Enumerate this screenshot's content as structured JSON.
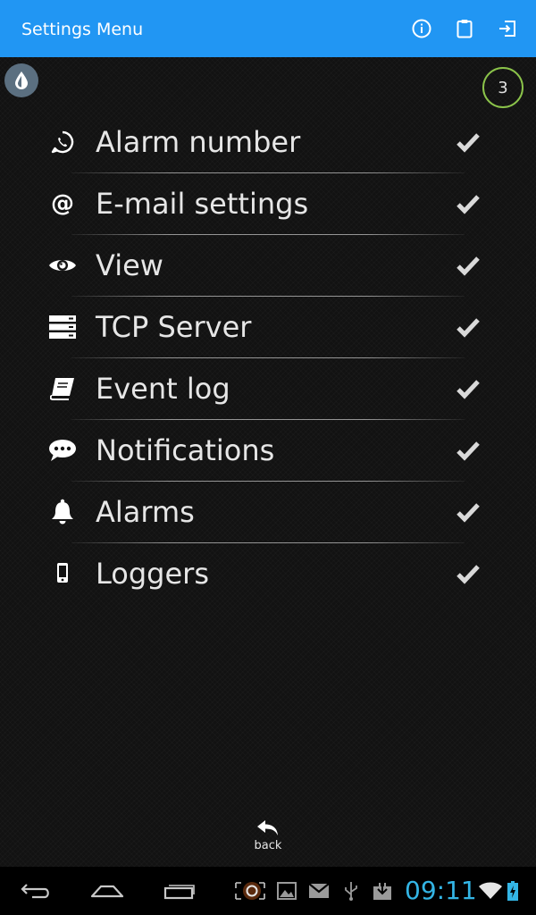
{
  "app_bar": {
    "title": "Settings Menu",
    "icons": [
      "info-icon",
      "clipboard-icon",
      "logout-icon"
    ],
    "color": "#2196f3"
  },
  "badge": {
    "count": "3",
    "color": "#8bc34a"
  },
  "menu": {
    "items": [
      {
        "label": "Alarm number",
        "icon": "whatsapp-icon"
      },
      {
        "label": "E-mail settings",
        "icon": "at-icon"
      },
      {
        "label": "View",
        "icon": "eye-icon"
      },
      {
        "label": "TCP Server",
        "icon": "server-icon"
      },
      {
        "label": "Event log",
        "icon": "book-icon"
      },
      {
        "label": "Notifications",
        "icon": "chat-icon"
      },
      {
        "label": "Alarms",
        "icon": "bell-icon"
      },
      {
        "label": "Loggers",
        "icon": "mobile-icon"
      }
    ],
    "check_icon": "checkmark-icon"
  },
  "footer": {
    "back_label": "back"
  },
  "system_bar": {
    "time": "09:11",
    "time_color": "#33b5e5"
  }
}
